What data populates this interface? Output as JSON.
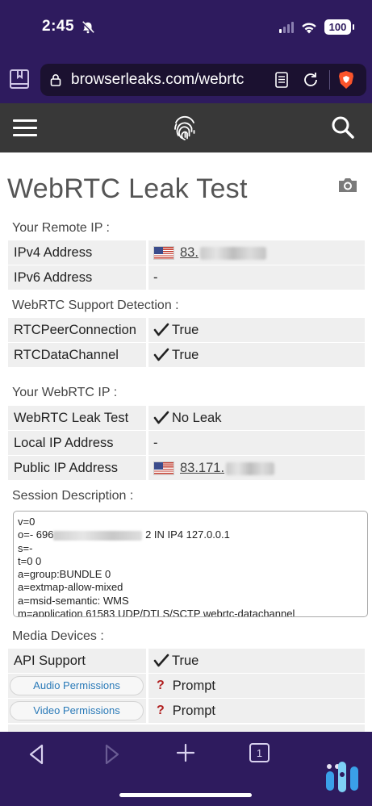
{
  "status_bar": {
    "time": "2:45",
    "battery": "100"
  },
  "browser": {
    "url": "browserleaks.com/webrtc"
  },
  "page": {
    "title": "WebRTC Leak Test"
  },
  "sections": {
    "remote_ip": "Your Remote IP :",
    "webrtc_support": "WebRTC Support Detection :",
    "webrtc_ip": "Your WebRTC IP :",
    "session_description": "Session Description :",
    "media_devices": "Media Devices :"
  },
  "remote_ip": {
    "ipv4_label": "IPv4 Address",
    "ipv4_value": "83.",
    "ipv6_label": "IPv6 Address",
    "ipv6_value": "-"
  },
  "support": {
    "peer_label": "RTCPeerConnection",
    "peer_value": "True",
    "channel_label": "RTCDataChannel",
    "channel_value": "True"
  },
  "webrtc_ip": {
    "leak_label": "WebRTC Leak Test",
    "leak_value": "No Leak",
    "local_label": "Local IP Address",
    "local_value": "-",
    "public_label": "Public IP Address",
    "public_value": "83.171."
  },
  "sdp": {
    "line1": "v=0",
    "line2_prefix": "o=- 696",
    "line2_suffix": "2 IN IP4 127.0.0.1",
    "line3": "s=-",
    "line4": "t=0 0",
    "line5": "a=group:BUNDLE 0",
    "line6": "a=extmap-allow-mixed",
    "line7": "a=msid-semantic: WMS",
    "line8": "m=application 61583 UDP/DTLS/SCTP webrtc-datachannel"
  },
  "media": {
    "api_label": "API Support",
    "api_value": "True",
    "audio_button": "Audio Permissions",
    "audio_value": "Prompt",
    "video_button": "Video Permissions",
    "video_value": "Prompt"
  },
  "tabs": {
    "count": "1"
  },
  "colors": {
    "chrome_purple": "#2e1b5e",
    "site_header": "#383838",
    "link_blue": "#2a7ab8",
    "question_red": "#b01e1e"
  }
}
